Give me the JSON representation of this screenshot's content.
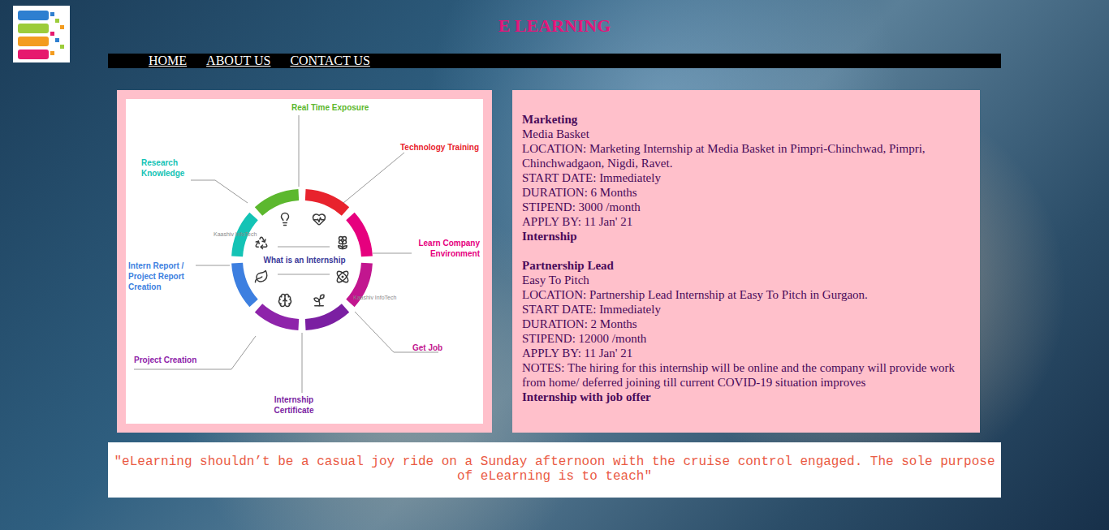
{
  "header": {
    "title": "E LEARNING"
  },
  "nav": [
    {
      "label": "HOME"
    },
    {
      "label": "ABOUT US"
    },
    {
      "label": "CONTACT US"
    }
  ],
  "diagram": {
    "center": "What is an Internship",
    "watermark": "Kaashiv InfoTech",
    "items": [
      {
        "label": "Technology Training",
        "color": "#e8232d"
      },
      {
        "label": "Learn Company Environment",
        "color": "#e6007e"
      },
      {
        "label": "Get Job",
        "color": "#c2168f"
      },
      {
        "label": "Internship Certificate",
        "color": "#7b1fa2"
      },
      {
        "label": "Project Creation",
        "color": "#8e24aa"
      },
      {
        "label": "Intern Report / Project Report Creation",
        "color": "#3d7fe0"
      },
      {
        "label": "Research Knowledge",
        "color": "#14c3b5"
      },
      {
        "label": "Real Time Exposure",
        "color": "#5cb82e"
      }
    ]
  },
  "listings": [
    {
      "title": "Marketing",
      "company": "Media Basket",
      "fields": [
        "LOCATION: Marketing Internship at Media Basket in Pimpri-Chinchwad, Pimpri, Chinchwadgaon, Nigdi, Ravet.",
        "START DATE: Immediately",
        "DURATION: 6 Months",
        "STIPEND: 3000 /month",
        "APPLY BY: 11 Jan' 21"
      ],
      "tag": "Internship"
    },
    {
      "title": "Partnership Lead",
      "company": "Easy To Pitch",
      "fields": [
        "LOCATION: Partnership Lead Internship at Easy To Pitch in Gurgaon.",
        "START DATE: Immediately",
        "DURATION: 2 Months",
        "STIPEND: 12000 /month",
        "APPLY BY: 11 Jan' 21",
        "NOTES: The hiring for this internship will be online and the company will provide work from home/ deferred joining till current COVID-19 situation improves"
      ],
      "tag": "Internship with job offer"
    }
  ],
  "quote": "\"eLearning shouldn’t be a casual joy ride on a Sunday afternoon with the cruise control engaged. The sole purpose of eLearning is to teach\""
}
